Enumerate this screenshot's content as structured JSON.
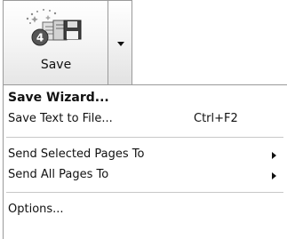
{
  "save_button": {
    "label": "Save",
    "icon": "save-wizard-icon",
    "badge": "4"
  },
  "menu": {
    "items": [
      {
        "label": "Save Wizard...",
        "shortcut": "",
        "bold": true
      },
      {
        "label": "Save Text to File...",
        "shortcut": "Ctrl+F2",
        "bold": false
      },
      {
        "label": "Send Selected Pages To",
        "shortcut": "",
        "submenu": true
      },
      {
        "label": "Send All Pages To",
        "shortcut": "",
        "submenu": true
      },
      {
        "label": "Options...",
        "shortcut": ""
      }
    ]
  }
}
